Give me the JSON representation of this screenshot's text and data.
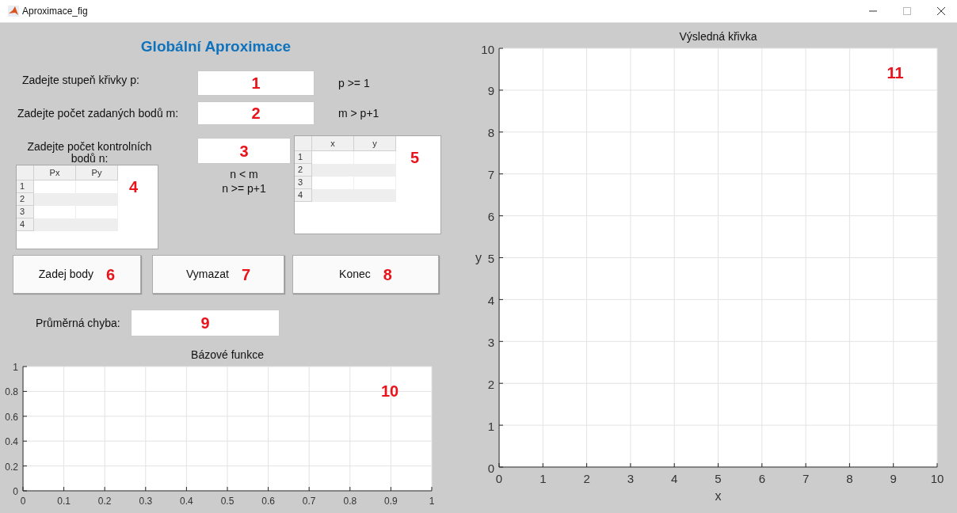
{
  "window": {
    "title": "Aproximace_fig"
  },
  "heading": "Globální Aproximace",
  "inputs": [
    {
      "label": "Zadejte stupeň křivky p:",
      "hint_lines": [
        "p >= 1"
      ],
      "annotation": "1"
    },
    {
      "label": "Zadejte počet zadaných bodů m:",
      "hint_lines": [
        "m > p+1"
      ],
      "annotation": "2"
    },
    {
      "label": "Zadejte počet kontrolních bodů n:",
      "hint_lines": [
        "n < m",
        "n >= p+1"
      ],
      "annotation": "3"
    }
  ],
  "tables": [
    {
      "columns": [
        "Px",
        "Py"
      ],
      "row_headers": [
        "1",
        "2",
        "3",
        "4"
      ],
      "annotation": "4"
    },
    {
      "columns": [
        "x",
        "y"
      ],
      "row_headers": [
        "1",
        "2",
        "3",
        "4"
      ],
      "annotation": "5"
    }
  ],
  "buttons": [
    {
      "label": "Zadej body",
      "annotation": "6"
    },
    {
      "label": "Vymazat",
      "annotation": "7"
    },
    {
      "label": "Konec",
      "annotation": "8"
    }
  ],
  "error_row": {
    "label": "Průměrná chyba:",
    "annotation": "9"
  },
  "basis_plot": {
    "annotation": "10",
    "chart_data": {
      "type": "line",
      "grid": true,
      "title": "Bázové funkce",
      "xlim": [
        0,
        1
      ],
      "ylim": [
        0,
        1
      ],
      "xticks": [
        0,
        0.1,
        0.2,
        0.3,
        0.4,
        0.5,
        0.6,
        0.7,
        0.8,
        0.9,
        1
      ],
      "yticks": [
        0,
        0.2,
        0.4,
        0.6,
        0.8,
        1
      ]
    }
  },
  "result_plot": {
    "annotation": "11",
    "chart_data": {
      "type": "line",
      "grid": true,
      "title": "Výsledná křivka",
      "xlabel": "x",
      "ylabel": "y",
      "xlim": [
        0,
        10
      ],
      "ylim": [
        0,
        10
      ],
      "xticks": [
        0,
        1,
        2,
        3,
        4,
        5,
        6,
        7,
        8,
        9,
        10
      ],
      "yticks": [
        0,
        1,
        2,
        3,
        4,
        5,
        6,
        7,
        8,
        9,
        10
      ]
    }
  }
}
